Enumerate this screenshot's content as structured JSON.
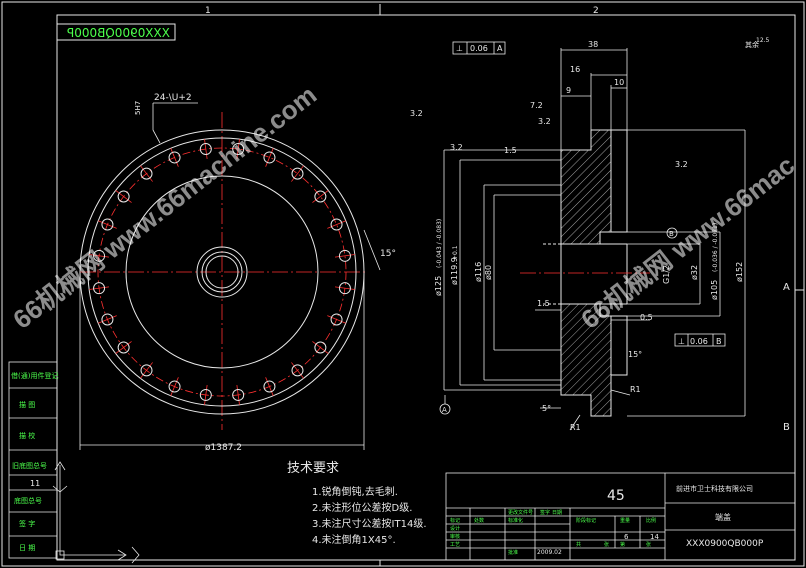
{
  "drawing": {
    "code_mirrored": "XXX0900QB000P",
    "code": "XXX0900QB000P",
    "zone_top_1": "1",
    "zone_top_2": "2",
    "zone_right_b": "B",
    "zone_right_a": "A",
    "watermark": "66机械网 www.66machine.com",
    "watermark_partial": "66机械网 www.66mac"
  },
  "front_view": {
    "hole_callout": "24-\\U+2",
    "hole_depth": "5H7",
    "angle": "15°",
    "diameter": "ø1387.2"
  },
  "section_view": {
    "flatness": "0.06",
    "flatness_ref": "A",
    "perp": "0.06",
    "perp_ref": "B",
    "dims": [
      "38",
      "16",
      "10",
      "9",
      "7.2",
      "1.5",
      "1.5",
      "0.5",
      "15°",
      "R1",
      "R1",
      "5°",
      "3.2",
      "3.2",
      "3.2",
      "3.2"
    ],
    "d_left_1": "ø125",
    "d_left_1_tol": "(-0.043 / -0.083)",
    "d_left_2": "ø119.9",
    "d_left_2_tol": "+0.1",
    "d_left_3": "ø116",
    "d_left_4": "ø80",
    "d_right_1": "ø32",
    "d_right_2": "ø105",
    "d_right_2_tol": "(-0.036 / -0.071)",
    "d_right_3": "ø152",
    "thread": "G1/2",
    "surface_note": "其余",
    "surface_value": "12.5",
    "datum_a": "A",
    "datum_b": "B"
  },
  "tech_req": {
    "title": "技术要求",
    "items": [
      "1.锐角倒钝,去毛刺.",
      "2.未注形位公差按D级.",
      "3.未注尺寸公差按IT14级.",
      "4.未注倒角1X45°."
    ]
  },
  "left_strip": {
    "labels": [
      "借(通)用件登记",
      "描 图",
      "描 校",
      "旧底图总号",
      "底图总号",
      "签 字",
      "日 期"
    ],
    "value": "11"
  },
  "title_block": {
    "company": "前进市卫士科技有限公司",
    "part_name": "端盖",
    "code": "XXX0900QB000P",
    "material": "45",
    "labels": [
      "标记",
      "处数",
      "更改文件号",
      "签字",
      "日期",
      "设计",
      "标准化",
      "审核",
      "工艺",
      "阶段标记",
      "重量",
      "比例",
      "共",
      "张",
      "第",
      "张",
      "批准"
    ],
    "date": "2009.02",
    "sheet_total": "6",
    "sheet_no": "14"
  }
}
